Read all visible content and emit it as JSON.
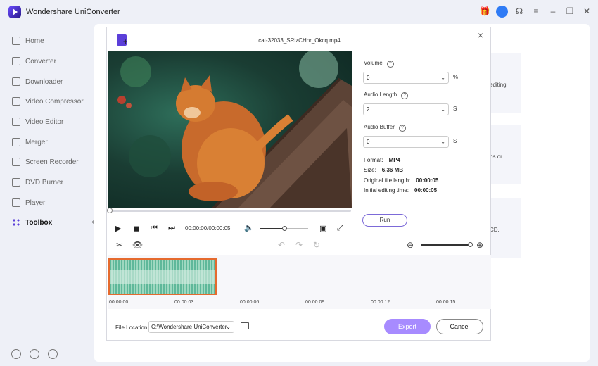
{
  "app": {
    "title": "Wondershare UniConverter"
  },
  "titlebar_icons": [
    "gift-icon",
    "avatar-icon",
    "headset-icon",
    "menu-icon",
    "minimize-icon",
    "restore-icon",
    "close-icon"
  ],
  "sidebar": {
    "items": [
      {
        "label": "Home",
        "icon": "home-icon",
        "active": false
      },
      {
        "label": "Converter",
        "icon": "converter-icon",
        "active": false
      },
      {
        "label": "Downloader",
        "icon": "downloader-icon",
        "active": false
      },
      {
        "label": "Video Compressor",
        "icon": "compressor-icon",
        "active": false
      },
      {
        "label": "Video Editor",
        "icon": "scissors-icon",
        "active": false
      },
      {
        "label": "Merger",
        "icon": "merger-icon",
        "active": false
      },
      {
        "label": "Screen Recorder",
        "icon": "recorder-icon",
        "active": false
      },
      {
        "label": "DVD Burner",
        "icon": "dvd-icon",
        "active": false
      },
      {
        "label": "Player",
        "icon": "player-icon",
        "active": false
      },
      {
        "label": "Toolbox",
        "icon": "toolbox-icon",
        "active": true
      }
    ],
    "collapse_glyph": "‹"
  },
  "background_cards": [
    "editing",
    "os or",
    "CD."
  ],
  "dialog": {
    "title": "cat-32033_SRizCHnr_Okcq.mp4",
    "close_glyph": "×",
    "player": {
      "time": "00:00:00/00:00:05",
      "volume_fraction": 0.5
    },
    "settings": {
      "volume": {
        "label": "Volume",
        "value": "0",
        "unit": "%"
      },
      "audio_length": {
        "label": "Audio Length",
        "value": "2",
        "unit": "S"
      },
      "audio_buffer": {
        "label": "Audio Buffer",
        "value": "0",
        "unit": "S"
      }
    },
    "info": {
      "format_label": "Format:",
      "format_value": "MP4",
      "size_label": "Size:",
      "size_value": "6.36 MB",
      "orig_label": "Original file length:",
      "orig_value": "00:00:05",
      "init_label": "Initial editing time:",
      "init_value": "00:00:05"
    },
    "run_label": "Run",
    "zoom_fraction": 1.0,
    "timeline_ticks": [
      "00:00:00",
      "00:00:03",
      "00:00:06",
      "00:00:09",
      "00:00:12",
      "00:00:15"
    ],
    "footer": {
      "file_location_label": "File Location:",
      "file_location_value": "C:\\Wondershare UniConverter",
      "export_label": "Export",
      "cancel_label": "Cancel"
    }
  }
}
